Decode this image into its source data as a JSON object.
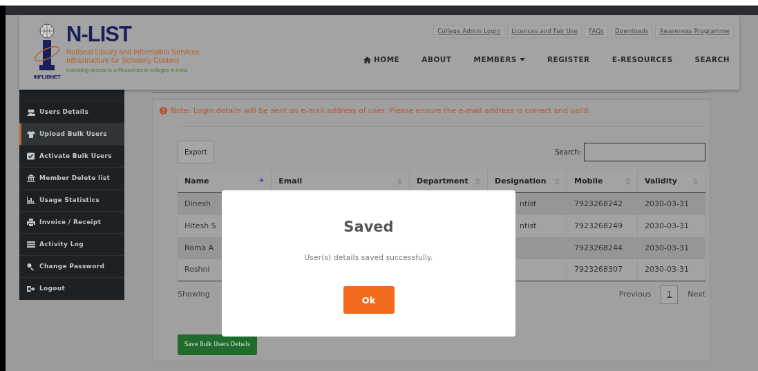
{
  "brand": {
    "logo_caption": "INFLIBNET",
    "title": "N-LIST",
    "subtitle_lines": [
      "National Library and Information Services",
      "Infrastructure for Scholorly Content"
    ],
    "tagline": "extending access to e-Resources to colleges in India"
  },
  "top_links": [
    "College Admin Login",
    "Licences and Fair Use",
    "FAQs",
    "Downloads",
    "Awareness Programme"
  ],
  "nav": [
    {
      "label": "HOME",
      "kind": "home"
    },
    {
      "label": "ABOUT",
      "kind": "plain"
    },
    {
      "label": "MEMBERS",
      "kind": "dropdown"
    },
    {
      "label": "REGISTER",
      "kind": "plain"
    },
    {
      "label": "E-RESOURCES",
      "kind": "plain"
    },
    {
      "label": "SEARCH",
      "kind": "plain"
    }
  ],
  "sidebar": {
    "items": [
      {
        "label": "Users Details",
        "selected": false
      },
      {
        "label": "Upload Bulk Users",
        "selected": true
      },
      {
        "label": "Activate Bulk Users",
        "selected": false
      },
      {
        "label": "Member Delete list",
        "selected": false
      },
      {
        "label": "Usage Statistics",
        "selected": false
      },
      {
        "label": "Invoice / Receipt",
        "selected": false
      },
      {
        "label": "Activity Log",
        "selected": false
      },
      {
        "label": "Change Password",
        "selected": false
      },
      {
        "label": "Logout",
        "selected": false
      }
    ]
  },
  "note": "Note: Login details will be sent on e-mail address of user. Please ensure the e-mail address is correct and valid.",
  "export_button": "Export",
  "search": {
    "label": "Search:"
  },
  "table": {
    "columns": [
      {
        "label": "Name",
        "sorted": true
      },
      {
        "label": "Email",
        "sorted": false
      },
      {
        "label": "Department",
        "sorted": false
      },
      {
        "label": "Designation",
        "sorted": false
      },
      {
        "label": "Mobile",
        "sorted": false
      },
      {
        "label": "Validity",
        "sorted": false
      }
    ],
    "rows": [
      [
        "Dinesh",
        "",
        "",
        "ntist",
        "7923268242",
        "2030-03-31"
      ],
      [
        "Hitesh S",
        "",
        "",
        "ntist",
        "7923268249",
        "2030-03-31"
      ],
      [
        "Roma A",
        "",
        "",
        "",
        "7923268244",
        "2030-03-31"
      ],
      [
        "Roshni",
        "",
        "",
        "",
        "7923268307",
        "2030-03-31"
      ]
    ]
  },
  "info": "Showing",
  "pagination": {
    "previous": "Previous",
    "pages": [
      {
        "label": "1",
        "selected": true
      }
    ],
    "next": "Next"
  },
  "save_button": "Save Bulk Users Details",
  "dialog": {
    "title": "Saved",
    "message": "User(s) details saved successfully.",
    "button": "Ok"
  }
}
